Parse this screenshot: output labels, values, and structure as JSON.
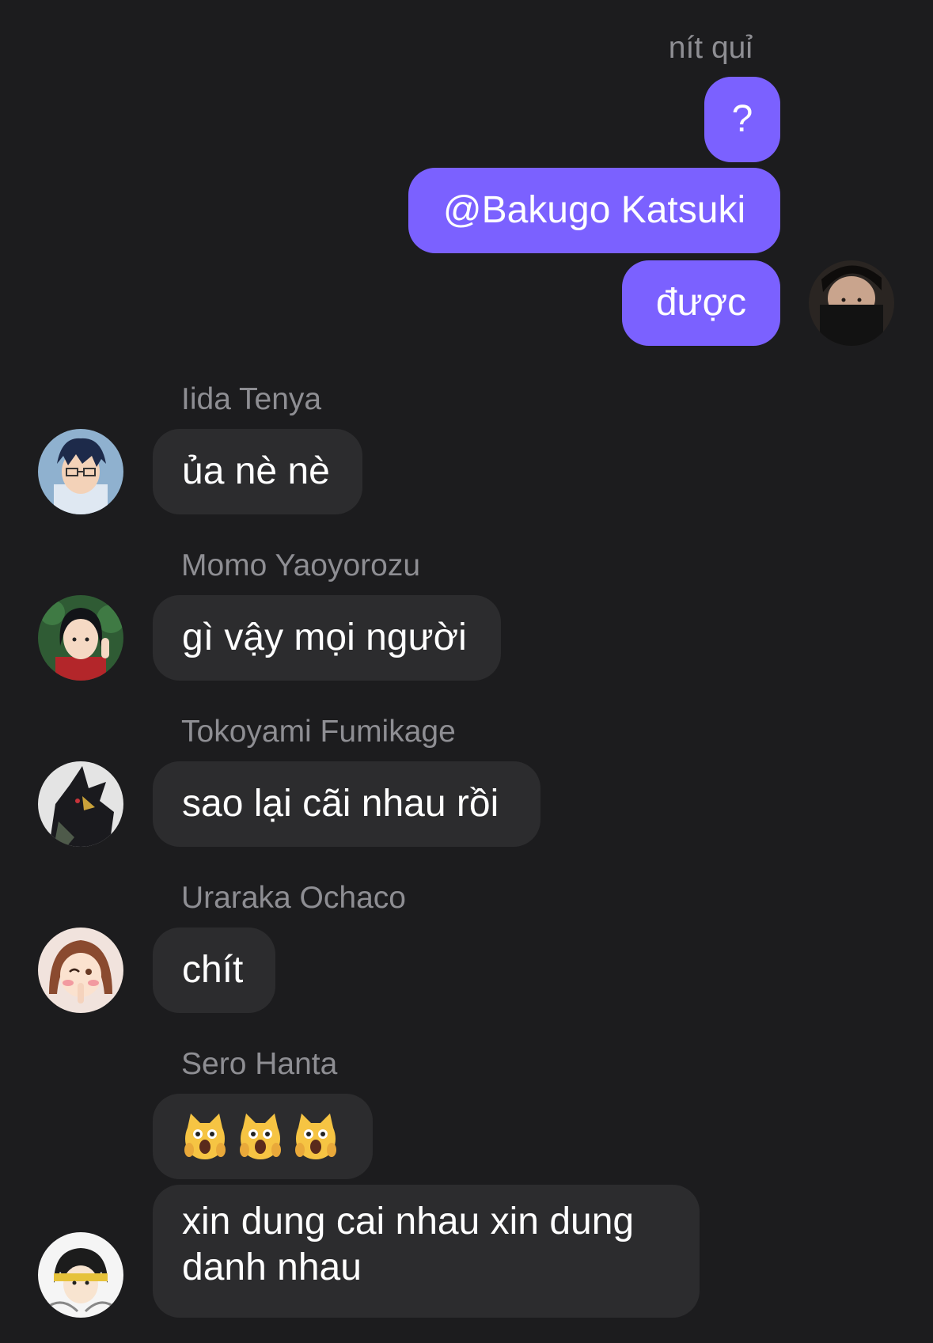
{
  "outgoing": {
    "sender_name": "nít quỉ",
    "messages": [
      "?",
      "@Bakugo Katsuki",
      "được"
    ]
  },
  "incoming": [
    {
      "sender": "Iida Tenya",
      "messages": [
        "ủa nè nè"
      ]
    },
    {
      "sender": "Momo Yaoyorozu",
      "messages": [
        "gì vậy mọi người"
      ]
    },
    {
      "sender": "Tokoyami Fumikage",
      "messages": [
        "sao lại cãi nhau rồi"
      ]
    },
    {
      "sender": "Uraraka Ochaco",
      "messages": [
        "chít"
      ]
    },
    {
      "sender": "Sero Hanta",
      "messages": [
        "😱😱😱",
        "xin dung cai nhau xin dung danh nhau"
      ]
    }
  ],
  "icons": {
    "cat_emoji": "weary-cat-face-icon"
  },
  "colors": {
    "background": "#1c1c1e",
    "outgoing_bubble": "#7b61ff",
    "incoming_bubble": "#2c2c2e",
    "sender_name": "#8e8e93"
  }
}
